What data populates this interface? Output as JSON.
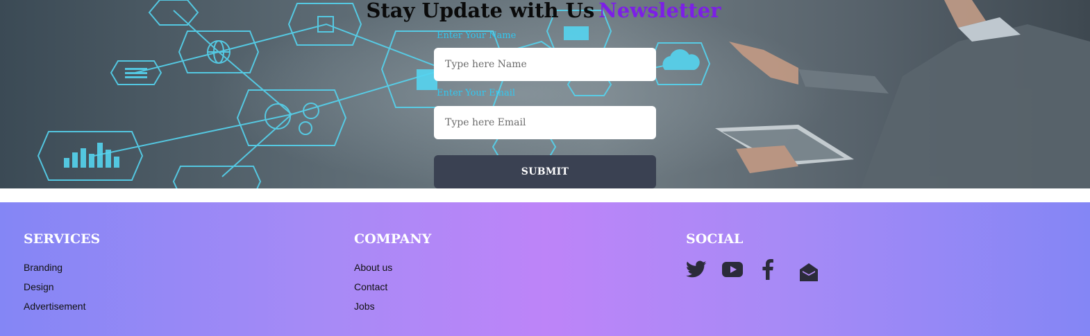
{
  "newsletter": {
    "title_prefix": "Stay Update with Us",
    "title_accent": "Newsletter",
    "name_label": "Enter Your Name",
    "name_placeholder": "Type here Name",
    "email_label": "Enter Your Email",
    "email_placeholder": "Type here Email",
    "submit_label": "SUBMIT"
  },
  "footer": {
    "services": {
      "title": "SERVICES",
      "links": [
        "Branding",
        "Design",
        "Advertisement"
      ]
    },
    "company": {
      "title": "COMPANY",
      "links": [
        "About us",
        "Contact",
        "Jobs"
      ]
    },
    "social": {
      "title": "SOCIAL",
      "icons": [
        "twitter-icon",
        "youtube-icon",
        "facebook-icon",
        "email-icon"
      ]
    }
  },
  "colors": {
    "accent_purple": "#7c1fe6",
    "label_cyan": "#31c8f0",
    "submit_bg": "#3a4152",
    "icon_dark": "#2b2b3a"
  }
}
